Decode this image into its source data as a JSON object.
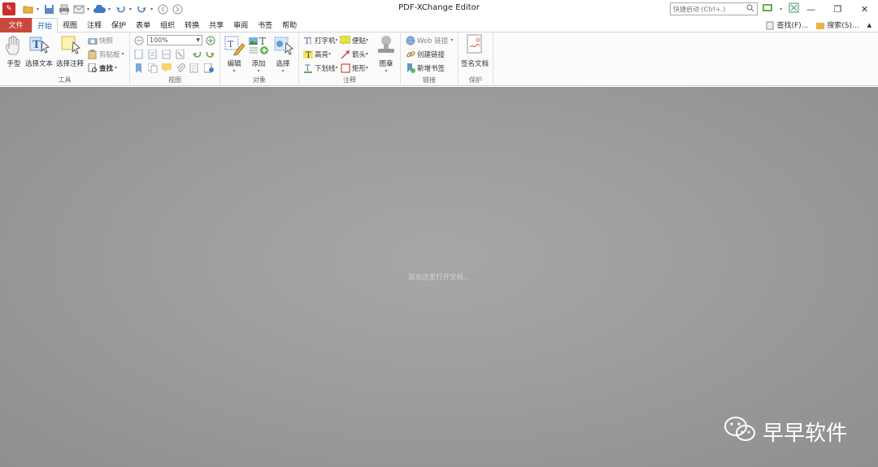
{
  "titlebar": {
    "title": "PDF-XChange Editor",
    "quick_launch_placeholder": "快捷启动 (Ctrl+.)",
    "window_controls": {
      "minimize": "—",
      "restore": "❐",
      "close": "✕"
    }
  },
  "menu": {
    "file": "文件",
    "tabs": [
      "开始",
      "视图",
      "注释",
      "保护",
      "表单",
      "组织",
      "转换",
      "共享",
      "审阅",
      "书签",
      "帮助"
    ],
    "active_tab": "开始",
    "find_label": "查找(F)...",
    "search_label": "搜索(S)..."
  },
  "ribbon": {
    "tools": {
      "label": "工具",
      "hand": "手型",
      "select_text": "选择文本",
      "select_annot": "选择注释",
      "snapshot": "快照",
      "clipboard": "剪贴板",
      "find": "查找"
    },
    "view": {
      "label": "视图",
      "zoom_value": "100%"
    },
    "objects": {
      "label": "对象",
      "edit": "编辑",
      "add": "添加",
      "select": "选择"
    },
    "comments": {
      "label": "注释",
      "typewriter": "打字机",
      "sticky": "便贴",
      "highlight": "高亮",
      "arrow": "箭头",
      "underline": "下划线",
      "rectangle": "矩形",
      "stamp": "图章"
    },
    "links": {
      "label": "链接",
      "web_links": "Web 链接",
      "create_link": "创建链接",
      "new_bookmark": "新增书签"
    },
    "protect": {
      "label": "保护",
      "sign_document": "签名文档"
    }
  },
  "workspace": {
    "hint": "双击这里打开文档...",
    "watermark": "早早软件"
  }
}
